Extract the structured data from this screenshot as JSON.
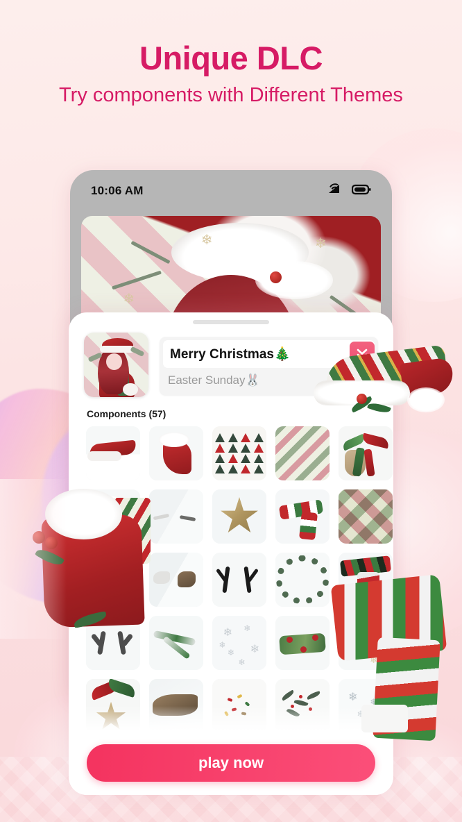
{
  "promo": {
    "headline": "Unique DLC",
    "subhead": "Try components with Different Themes",
    "accent_color": "#d61b65",
    "background_color": "#fdeeec"
  },
  "phone": {
    "status_bar": {
      "time": "10:06 AM",
      "icons": [
        "wifi-signal-icon",
        "battery-icon"
      ]
    },
    "banner": {
      "alt": "christmas-character-banner"
    }
  },
  "sheet": {
    "grabber": "drag-handle",
    "avatar": "character-thumbnail",
    "theme_select": {
      "selected": "Merry Christmas🎄",
      "alternate": "Easter Sunday🐰",
      "chevron_icon": "chevron-double-down-icon",
      "chevron_color": "#ef5074"
    },
    "components_label": "Components (57)",
    "components_count": 57,
    "grid": [
      [
        {
          "name": "santa-hat"
        },
        {
          "name": "santa-coat"
        },
        {
          "name": "christmas-tree-pattern"
        },
        {
          "name": "candy-stripe-pattern"
        },
        {
          "name": "ribbon-bow-sack"
        }
      ],
      [
        {
          "name": "santa-hat-fur"
        },
        {
          "name": "white-antlers"
        },
        {
          "name": "gold-star"
        },
        {
          "name": "striped-scarf"
        },
        {
          "name": "argyle-pattern"
        }
      ],
      [
        {
          "name": "holly-sprig"
        },
        {
          "name": "reindeer-dove"
        },
        {
          "name": "black-antlers"
        },
        {
          "name": "holly-wreath"
        },
        {
          "name": "knit-scarf"
        }
      ],
      [
        {
          "name": "grey-antlers"
        },
        {
          "name": "snowy-branch"
        },
        {
          "name": "snowflakes"
        },
        {
          "name": "leaf-garland"
        },
        {
          "name": "snow-scarf"
        }
      ],
      [
        {
          "name": "star-bow"
        },
        {
          "name": "brown-wing"
        },
        {
          "name": "confetti-candy"
        },
        {
          "name": "botanical-sprigs"
        },
        {
          "name": "snowflake-pattern"
        }
      ]
    ],
    "cta": {
      "label": "play now",
      "color_start": "#f4335f",
      "color_end": "#fb4f79"
    }
  },
  "decorations": [
    {
      "name": "striped-santa-hat-prop"
    },
    {
      "name": "red-santa-coat-prop"
    },
    {
      "name": "striped-scarf-prop"
    },
    {
      "name": "lavender-blob"
    },
    {
      "name": "pink-bubbles"
    }
  ]
}
